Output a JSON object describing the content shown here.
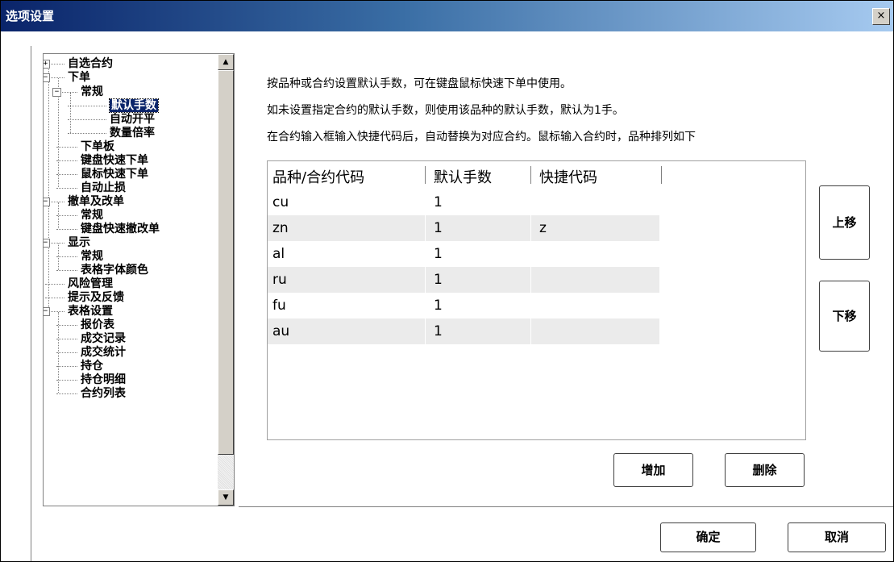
{
  "window": {
    "title": "选项设置",
    "close_label": "×"
  },
  "tree": {
    "items": [
      {
        "label": "自选合约"
      },
      {
        "label": "下单"
      },
      {
        "label": "常规"
      },
      {
        "label": "默认手数"
      },
      {
        "label": "自动开平"
      },
      {
        "label": "数量倍率"
      },
      {
        "label": "下单板"
      },
      {
        "label": "键盘快速下单"
      },
      {
        "label": "鼠标快速下单"
      },
      {
        "label": "自动止损"
      },
      {
        "label": "撤单及改单"
      },
      {
        "label": "常规"
      },
      {
        "label": "键盘快速撤改单"
      },
      {
        "label": "显示"
      },
      {
        "label": "常规"
      },
      {
        "label": "表格字体颜色"
      },
      {
        "label": "风险管理"
      },
      {
        "label": "提示及反馈"
      },
      {
        "label": "表格设置"
      },
      {
        "label": "报价表"
      },
      {
        "label": "成交记录"
      },
      {
        "label": "成交统计"
      },
      {
        "label": "持仓"
      },
      {
        "label": "持仓明细"
      },
      {
        "label": "合约列表"
      }
    ],
    "selected_index": 3,
    "expand_plus": "+",
    "expand_minus": "−",
    "scroll_up": "▲",
    "scroll_down": "▼"
  },
  "description": {
    "line1": "按品种或合约设置默认手数，可在键盘鼠标快速下单中使用。",
    "line2": "如未设置指定合约的默认手数，则使用该品种的默认手数，默认为1手。",
    "line3": "在合约输入框输入快捷代码后，自动替换为对应合约。鼠标输入合约时，品种排列如下"
  },
  "table": {
    "headers": [
      "品种/合约代码",
      "默认手数",
      "快捷代码"
    ],
    "rows": [
      [
        "cu",
        "1",
        ""
      ],
      [
        "zn",
        "1",
        "z"
      ],
      [
        "al",
        "1",
        ""
      ],
      [
        "ru",
        "1",
        ""
      ],
      [
        "fu",
        "1",
        ""
      ],
      [
        "au",
        "1",
        ""
      ]
    ]
  },
  "buttons": {
    "move_up": "上移",
    "move_down": "下移",
    "add": "增加",
    "delete": "删除",
    "ok": "确定",
    "cancel": "取消"
  },
  "colors": {
    "titlebar_start": "#0a246a",
    "titlebar_end": "#a6caf0",
    "selection": "#0a246a",
    "row_alt": "#ebebeb"
  }
}
